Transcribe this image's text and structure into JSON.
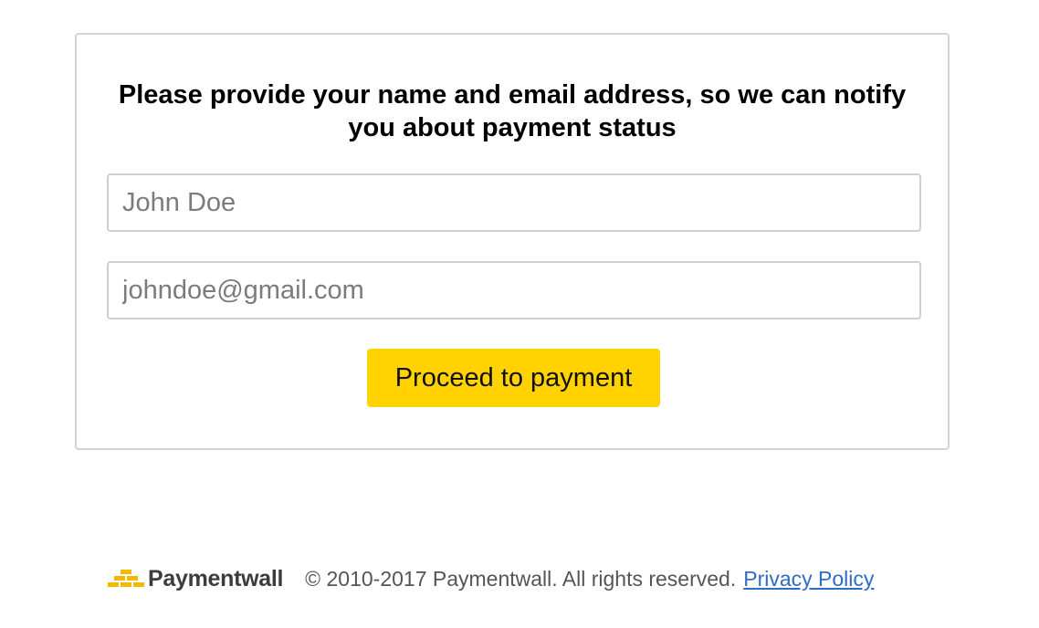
{
  "form": {
    "heading": "Please provide your name and email address, so we can notify you about payment status",
    "name_field": {
      "value": "",
      "placeholder": "John Doe"
    },
    "email_field": {
      "value": "",
      "placeholder": "johndoe@gmail.com"
    },
    "submit_label": "Proceed to payment"
  },
  "footer": {
    "brand": "Paymentwall",
    "copyright": "© 2010-2017 Paymentwall. All rights reserved.",
    "privacy_link": "Privacy Policy"
  },
  "colors": {
    "button_bg": "#ffd200",
    "link": "#2f6cc4",
    "logo_accent": "#f5b800"
  },
  "icons": {
    "logo": "paymentwall-logo-icon"
  }
}
